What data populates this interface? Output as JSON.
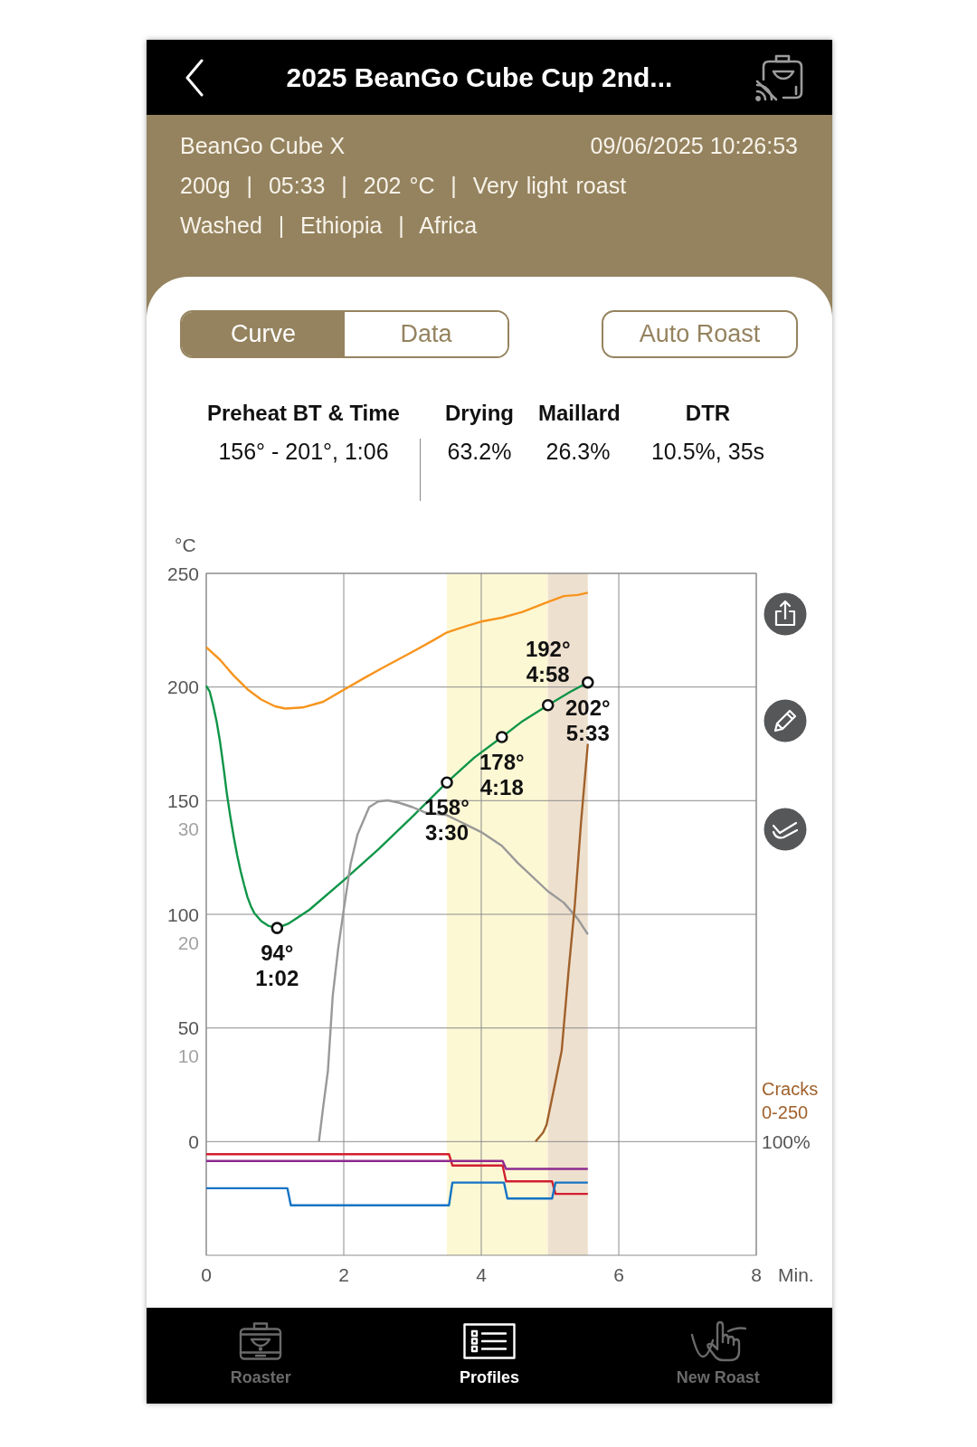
{
  "header": {
    "title": "2025 BeanGo Cube Cup 2nd..."
  },
  "info": {
    "roaster": "BeanGo Cube X",
    "datetime": "09/06/2025 10:26:53",
    "lines": [
      "200g  |  05:33  |  202 °C  |  Very light roast",
      "Washed  |  Ethiopia  |  Africa"
    ]
  },
  "view_tabs": [
    {
      "label": "Curve",
      "selected": true
    },
    {
      "label": "Data",
      "selected": false
    }
  ],
  "auto_roast_button": {
    "label": "Auto Roast"
  },
  "stats": [
    {
      "heading": "Preheat BT & Time",
      "value": "156° - 201°, 1:06"
    },
    {
      "heading": "Drying",
      "value": "63.2%"
    },
    {
      "heading": "Maillard",
      "value": "26.3%"
    },
    {
      "heading": "DTR",
      "value": "10.5%, 35s"
    }
  ],
  "chart": {
    "scale_label": "0-250",
    "percent_label": "100%",
    "chart_data": {
      "type": "line",
      "xlabel": "Min.",
      "ylabel": "°C",
      "grid": true,
      "xlim": [
        0,
        8
      ],
      "ylim": [
        -50,
        250
      ],
      "xticks": [
        0,
        2,
        4,
        6,
        8
      ],
      "yticks": [
        0,
        50,
        100,
        150,
        200,
        250
      ],
      "y2lim": [
        -7.53,
        52.47
      ],
      "y2ticks": [
        10,
        20,
        30
      ],
      "series": [
        {
          "color": "#f7941d",
          "axis": "y",
          "x": [
            0,
            0.2,
            0.4,
            0.6,
            0.8,
            1.0,
            1.15,
            1.4,
            1.7,
            2.0,
            2.3,
            2.6,
            3.0,
            3.3,
            3.5,
            3.8,
            4.0,
            4.3,
            4.6,
            4.97,
            5.2,
            5.4,
            5.55
          ],
          "values": [
            217.5,
            212,
            205,
            199,
            194.5,
            191.5,
            190.5,
            191,
            193.5,
            198.8,
            204,
            209,
            215.5,
            220.5,
            224,
            227,
            228.8,
            230.5,
            233,
            237.4,
            240,
            240.5,
            241.5
          ]
        },
        {
          "color": "#0f9548",
          "axis": "y",
          "x": [
            0,
            0.05,
            0.1,
            0.15,
            0.2,
            0.25,
            0.3,
            0.35,
            0.4,
            0.45,
            0.5,
            0.55,
            0.6,
            0.65,
            0.7,
            0.8,
            0.9,
            1.03,
            1.2,
            1.5,
            2.0,
            2.5,
            3.0,
            3.5,
            3.9,
            4.3,
            4.6,
            4.97,
            5.3,
            5.55
          ],
          "values": [
            200.5,
            198,
            192,
            185,
            176,
            165,
            153,
            143,
            134,
            126,
            119,
            113,
            107.5,
            103.5,
            100.5,
            97,
            95,
            94,
            96,
            102,
            115,
            128.5,
            143,
            158,
            169,
            178,
            185,
            192,
            198,
            202
          ]
        },
        {
          "color": "#999999",
          "axis": "y2",
          "x": [
            1.64,
            1.7,
            1.77,
            1.84,
            1.92,
            2.0,
            2.1,
            2.2,
            2.37,
            2.5,
            2.64,
            2.8,
            3.0,
            3.2,
            3.5,
            3.8,
            4.0,
            4.3,
            4.53,
            4.97,
            5.2,
            5.4,
            5.55
          ],
          "values": [
            2.5,
            5.5,
            8.7,
            15.3,
            19.5,
            22.9,
            26.9,
            29.5,
            31.9,
            32.4,
            32.5,
            32.3,
            31.9,
            31.4,
            31.2,
            30.3,
            29.7,
            28.5,
            27,
            24.5,
            23.5,
            22.1,
            20.7
          ]
        },
        {
          "name": "Cracks",
          "color": "#a0612b",
          "axis": "y",
          "x": [
            4.79,
            4.9,
            4.95,
            5.07,
            5.17,
            5.27,
            5.36,
            5.45,
            5.55
          ],
          "values": [
            0,
            4,
            7.4,
            25,
            40,
            75,
            104,
            140,
            175
          ]
        },
        {
          "color": "#d21f30",
          "axis": "y",
          "x": [
            0,
            3.53,
            3.58,
            4.31,
            4.36,
            5.03,
            5.08,
            5.55
          ],
          "values": [
            -5.5,
            -5.5,
            -10.5,
            -10.5,
            -17.5,
            -17.5,
            -23,
            -23
          ]
        },
        {
          "color": "#8e2a8e",
          "axis": "y",
          "x": [
            0,
            4.31,
            4.36,
            5.55
          ],
          "values": [
            -8.5,
            -8.5,
            -12,
            -12
          ]
        },
        {
          "color": "#1573c5",
          "axis": "y",
          "x": [
            0,
            1.18,
            1.23,
            3.53,
            3.58,
            4.33,
            4.38,
            5.03,
            5.08,
            5.55
          ],
          "values": [
            -20.5,
            -20.5,
            -28,
            -28,
            -18,
            -18,
            -25,
            -25,
            -18,
            -18
          ]
        }
      ],
      "bands": [
        {
          "axis": "x",
          "from": 3.5,
          "to": 4.97,
          "color": "#fdf8d4"
        },
        {
          "axis": "x",
          "from": 4.97,
          "to": 5.55,
          "color": "#eee0cf"
        }
      ],
      "annotations": [
        {
          "x": 1.03,
          "y": 94,
          "text": "94°\n1:02"
        },
        {
          "x": 3.5,
          "y": 158,
          "text": "158°\n3:30"
        },
        {
          "x": 4.3,
          "y": 178,
          "text": "178°\n4:18"
        },
        {
          "x": 4.97,
          "y": 192,
          "text": "192°\n4:58"
        },
        {
          "x": 5.55,
          "y": 202,
          "text": "202°\n5:33"
        }
      ]
    }
  },
  "tab_bar": [
    {
      "label": "Roaster",
      "selected": false
    },
    {
      "label": "Profiles",
      "selected": true
    },
    {
      "label": "New Roast",
      "selected": false
    }
  ]
}
